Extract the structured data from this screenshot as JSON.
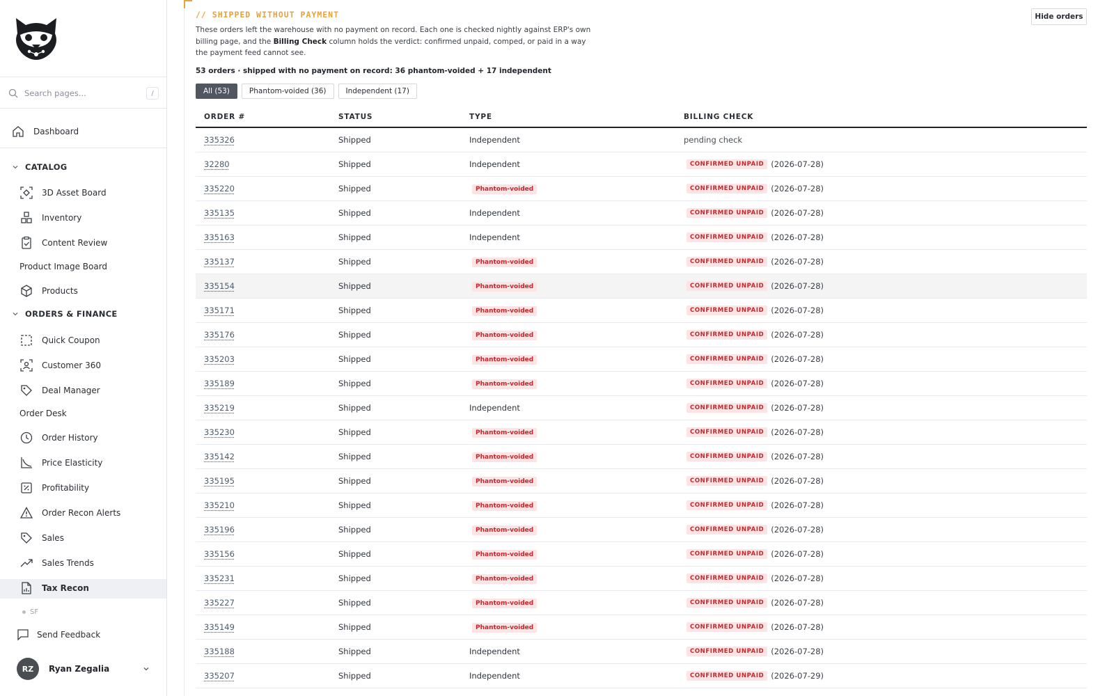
{
  "sidebar": {
    "search_placeholder": "Search pages...",
    "search_shortcut": "/",
    "dashboard": "Dashboard",
    "catalog_heading": "CATALOG",
    "catalog_items": [
      "3D Asset Board",
      "Inventory",
      "Content Review"
    ],
    "product_image_board": "Product Image Board",
    "products": "Products",
    "orders_heading": "ORDERS & FINANCE",
    "orders_items_a": [
      "Quick Coupon",
      "Customer 360",
      "Deal Manager"
    ],
    "order_desk": "Order Desk",
    "orders_items_b": [
      "Order History",
      "Price Elasticity",
      "Profitability",
      "Order Recon Alerts",
      "Sales",
      "Sales Trends",
      "Tax Recon"
    ],
    "sf_label": "SF",
    "feedback": "Send Feedback",
    "user_initials": "RZ",
    "user_name": "Ryan Zegalia"
  },
  "main": {
    "eyebrow": "// SHIPPED WITHOUT PAYMENT",
    "desc_part1": "These orders left the warehouse with no payment on record. Each one is checked nightly against ERP's own billing page, and the ",
    "desc_bold": "Billing Check",
    "desc_part2": " column holds the verdict: confirmed unpaid, comped, or paid in a way the payment feed cannot see.",
    "summary": "53 orders · shipped with no payment on record: 36 phantom-voided + 17 independent",
    "hide_button": "Hide orders",
    "filters": [
      "All (53)",
      "Phantom-voided (36)",
      "Independent (17)"
    ],
    "columns": [
      "ORDER #",
      "STATUS",
      "TYPE",
      "BILLING CHECK"
    ],
    "rows": [
      {
        "order": "335326",
        "status": "Shipped",
        "type": "Independent",
        "check": "pending check",
        "date": ""
      },
      {
        "order": "32280",
        "status": "Shipped",
        "type": "Independent",
        "check": "CONFIRMED UNPAID",
        "date": "(2026-07-28)"
      },
      {
        "order": "335220",
        "status": "Shipped",
        "type": "Phantom-voided",
        "check": "CONFIRMED UNPAID",
        "date": "(2026-07-28)"
      },
      {
        "order": "335135",
        "status": "Shipped",
        "type": "Independent",
        "check": "CONFIRMED UNPAID",
        "date": "(2026-07-28)"
      },
      {
        "order": "335163",
        "status": "Shipped",
        "type": "Independent",
        "check": "CONFIRMED UNPAID",
        "date": "(2026-07-28)"
      },
      {
        "order": "335137",
        "status": "Shipped",
        "type": "Phantom-voided",
        "check": "CONFIRMED UNPAID",
        "date": "(2026-07-28)"
      },
      {
        "order": "335154",
        "status": "Shipped",
        "type": "Phantom-voided",
        "check": "CONFIRMED UNPAID",
        "date": "(2026-07-28)"
      },
      {
        "order": "335171",
        "status": "Shipped",
        "type": "Phantom-voided",
        "check": "CONFIRMED UNPAID",
        "date": "(2026-07-28)"
      },
      {
        "order": "335176",
        "status": "Shipped",
        "type": "Phantom-voided",
        "check": "CONFIRMED UNPAID",
        "date": "(2026-07-28)"
      },
      {
        "order": "335203",
        "status": "Shipped",
        "type": "Phantom-voided",
        "check": "CONFIRMED UNPAID",
        "date": "(2026-07-28)"
      },
      {
        "order": "335189",
        "status": "Shipped",
        "type": "Phantom-voided",
        "check": "CONFIRMED UNPAID",
        "date": "(2026-07-28)"
      },
      {
        "order": "335219",
        "status": "Shipped",
        "type": "Independent",
        "check": "CONFIRMED UNPAID",
        "date": "(2026-07-28)"
      },
      {
        "order": "335230",
        "status": "Shipped",
        "type": "Phantom-voided",
        "check": "CONFIRMED UNPAID",
        "date": "(2026-07-28)"
      },
      {
        "order": "335142",
        "status": "Shipped",
        "type": "Phantom-voided",
        "check": "CONFIRMED UNPAID",
        "date": "(2026-07-28)"
      },
      {
        "order": "335195",
        "status": "Shipped",
        "type": "Phantom-voided",
        "check": "CONFIRMED UNPAID",
        "date": "(2026-07-28)"
      },
      {
        "order": "335210",
        "status": "Shipped",
        "type": "Phantom-voided",
        "check": "CONFIRMED UNPAID",
        "date": "(2026-07-28)"
      },
      {
        "order": "335196",
        "status": "Shipped",
        "type": "Phantom-voided",
        "check": "CONFIRMED UNPAID",
        "date": "(2026-07-28)"
      },
      {
        "order": "335156",
        "status": "Shipped",
        "type": "Phantom-voided",
        "check": "CONFIRMED UNPAID",
        "date": "(2026-07-28)"
      },
      {
        "order": "335231",
        "status": "Shipped",
        "type": "Phantom-voided",
        "check": "CONFIRMED UNPAID",
        "date": "(2026-07-28)"
      },
      {
        "order": "335227",
        "status": "Shipped",
        "type": "Phantom-voided",
        "check": "CONFIRMED UNPAID",
        "date": "(2026-07-28)"
      },
      {
        "order": "335149",
        "status": "Shipped",
        "type": "Phantom-voided",
        "check": "CONFIRMED UNPAID",
        "date": "(2026-07-28)"
      },
      {
        "order": "335188",
        "status": "Shipped",
        "type": "Independent",
        "check": "CONFIRMED UNPAID",
        "date": "(2026-07-28)"
      },
      {
        "order": "335207",
        "status": "Shipped",
        "type": "Independent",
        "check": "CONFIRMED UNPAID",
        "date": "(2026-07-29)"
      }
    ],
    "highlighted_row": "335154"
  },
  "colors": {
    "accent": "#e8a23c",
    "badge_bg": "#fde4e4",
    "badge_text": "#c1272d",
    "active_filter": "#505760"
  }
}
